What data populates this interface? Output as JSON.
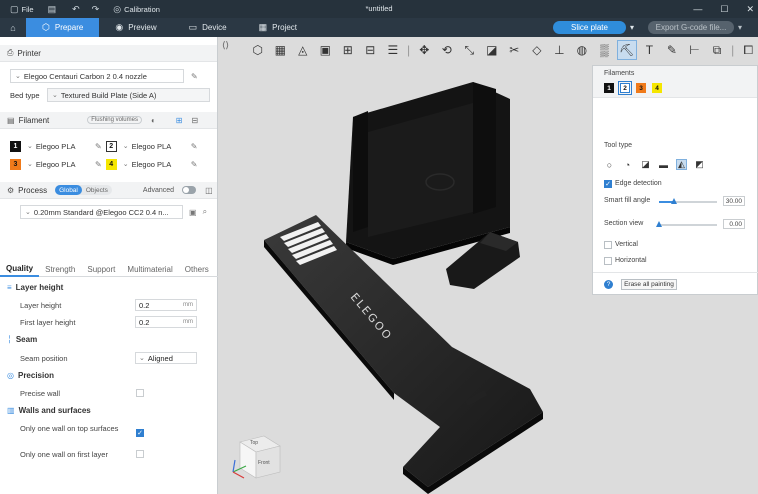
{
  "titlebar": {
    "file_label": "File",
    "calibration_label": "Calibration",
    "document_title": "*untitled"
  },
  "nav": {
    "tabs": [
      {
        "label": "Prepare",
        "icon": "cube-icon"
      },
      {
        "label": "Preview",
        "icon": "eye-icon"
      },
      {
        "label": "Device",
        "icon": "monitor-icon"
      },
      {
        "label": "Project",
        "icon": "document-icon"
      }
    ],
    "slice_label": "Slice plate",
    "export_label": "Export G-code file..."
  },
  "printer": {
    "section_label": "Printer",
    "model": "Elegoo Centauri Carbon 2 0.4 nozzle",
    "bed_type_label": "Bed type",
    "bed_type_value": "Textured Build Plate (Side A)"
  },
  "filament": {
    "section_label": "Filament",
    "flushing_label": "Flushing volumes",
    "slots": [
      {
        "index": "1",
        "name": "Elegoo PLA",
        "color": "#111111",
        "text_color": "#ffffff"
      },
      {
        "index": "2",
        "name": "Elegoo PLA",
        "color": "#ffffff",
        "text_color": "#111111"
      },
      {
        "index": "3",
        "name": "Elegoo PLA",
        "color": "#f07a1a",
        "text_color": "#111111"
      },
      {
        "index": "4",
        "name": "Elegoo PLA",
        "color": "#f5e600",
        "text_color": "#111111"
      }
    ]
  },
  "process": {
    "section_label": "Process",
    "global_label": "Global",
    "objects_label": "Objects",
    "advanced_label": "Advanced",
    "preset": "0.20mm Standard @Elegoo CC2 0.4 n...",
    "tabs": [
      "Quality",
      "Strength",
      "Support",
      "Multimaterial",
      "Others"
    ],
    "groups": {
      "layer_height": {
        "title": "Layer height",
        "layer_height_label": "Layer height",
        "layer_height_value": "0.2",
        "first_layer_label": "First layer height",
        "first_layer_value": "0.2",
        "unit": "mm"
      },
      "seam": {
        "title": "Seam",
        "position_label": "Seam position",
        "position_value": "Aligned"
      },
      "precision": {
        "title": "Precision",
        "precise_wall_label": "Precise wall"
      },
      "walls": {
        "title": "Walls and surfaces",
        "top_label": "Only one wall on top surfaces",
        "top_checked": true,
        "first_label": "Only one wall on first layer",
        "first_checked": false
      }
    }
  },
  "paint_panel": {
    "filaments_label": "Filaments",
    "swatches": [
      {
        "label": "1",
        "color": "#111111",
        "text_color": "#ffffff"
      },
      {
        "label": "2",
        "color": "#ffffff",
        "text_color": "#111111"
      },
      {
        "label": "3",
        "color": "#f07a1a",
        "text_color": "#111111"
      },
      {
        "label": "4",
        "color": "#f5e600",
        "text_color": "#111111"
      }
    ],
    "tool_type_label": "Tool type",
    "edge_detection_label": "Edge detection",
    "smart_fill_label": "Smart fill angle",
    "smart_fill_value": "30.00",
    "smart_fill_fraction": 0.25,
    "section_view_label": "Section view",
    "section_view_value": "0.00",
    "section_view_fraction": 0.0,
    "vertical_label": "Vertical",
    "horizontal_label": "Horizontal",
    "erase_label": "Erase all painting"
  },
  "text3d": {
    "logo": "ELEGOO"
  },
  "nav_cube": {
    "top_label": "Top",
    "front_label": "Front"
  }
}
